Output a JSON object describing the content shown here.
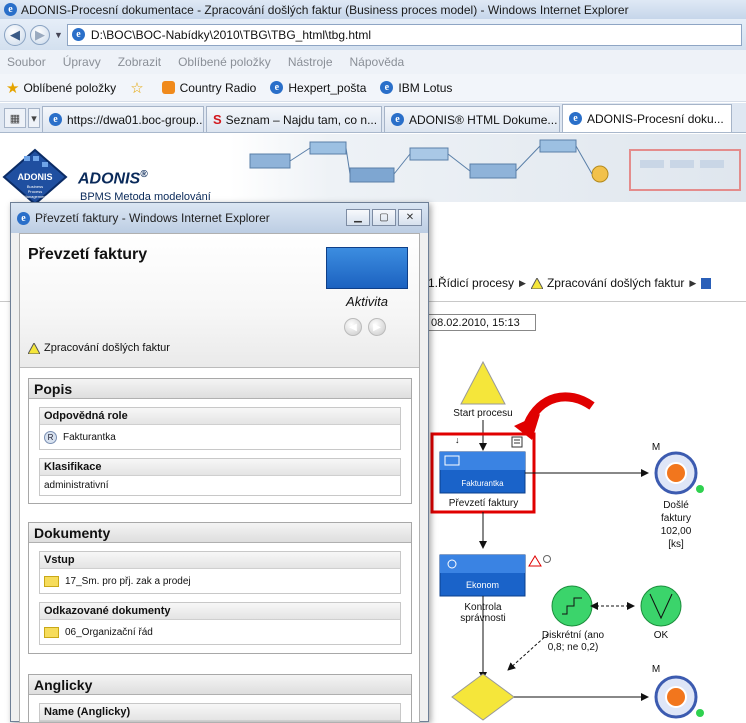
{
  "browser": {
    "window_title": "ADONIS-Procesní dokumentace - Zpracování došlých faktur (Business proces model) - Windows Internet Explorer",
    "address": "D:\\BOC\\BOC-Nabídky\\2010\\TBG\\TBG_html\\tbg.html",
    "menu": [
      "Soubor",
      "Úpravy",
      "Zobrazit",
      "Oblíbené položky",
      "Nástroje",
      "Nápověda"
    ],
    "favorites_label": "Oblíbené položky",
    "favorites": [
      "Country Radio",
      "Hexpert_pošta",
      "IBM Lotus"
    ],
    "tabs": [
      {
        "label": "https://dwa01.boc-group...."
      },
      {
        "label": "Seznam – Najdu tam, co n..."
      },
      {
        "label": "ADONIS® HTML Dokume..."
      },
      {
        "label": "ADONIS-Procesní doku..."
      }
    ]
  },
  "banner": {
    "logo_text": "ADONIS",
    "logo_sub": "Business Process Management",
    "product": "ADONIS",
    "reg": "®",
    "subtitle": "BPMS Metoda modelování"
  },
  "breadcrumb": [
    "1.Řídicí procesy",
    "Zpracování došlých faktur"
  ],
  "date": "08.02.2010, 15:13",
  "popup": {
    "title": "Převzetí faktury - Windows Internet Explorer",
    "heading": "Převzetí faktury",
    "type_label": "Aktivita",
    "process_link": "Zpracování došlých faktur",
    "sections": {
      "popis": {
        "title": "Popis",
        "role_label": "Odpovědná role",
        "role_value": "Fakturantka",
        "klasifikace_label": "Klasifikace",
        "klasifikace_value": "administrativní"
      },
      "dokumenty": {
        "title": "Dokumenty",
        "vstup_label": "Vstup",
        "vstup_value": "17_Sm. pro přj. zak a prodej",
        "odkaz_label": "Odkazované dokumenty",
        "odkaz_value": "06_Organizační řád"
      },
      "anglicky": {
        "title": "Anglicky",
        "name_label": "Name (Anglicky)"
      }
    }
  },
  "diagram": {
    "start": "Start procesu",
    "activity1_role": "Fakturantka",
    "activity1_name": "Převzetí faktury",
    "activity2_role": "Ekonom",
    "activity2_name_1": "Kontrola",
    "activity2_name_2": "správnosti",
    "doc_m": "M",
    "doc_name_1": "Došlé",
    "doc_name_2": "faktury",
    "doc_value": "102,00",
    "doc_unit": "[ks]",
    "discrete_1": "Diskrétní (ano",
    "discrete_2": "0,8; ne 0,2)",
    "ok": "OK",
    "m2": "M",
    "colors": {
      "activity": "#1a63c9",
      "highlight": "#e00000",
      "start": "#f5e63a",
      "result": "#3bd46b"
    }
  }
}
